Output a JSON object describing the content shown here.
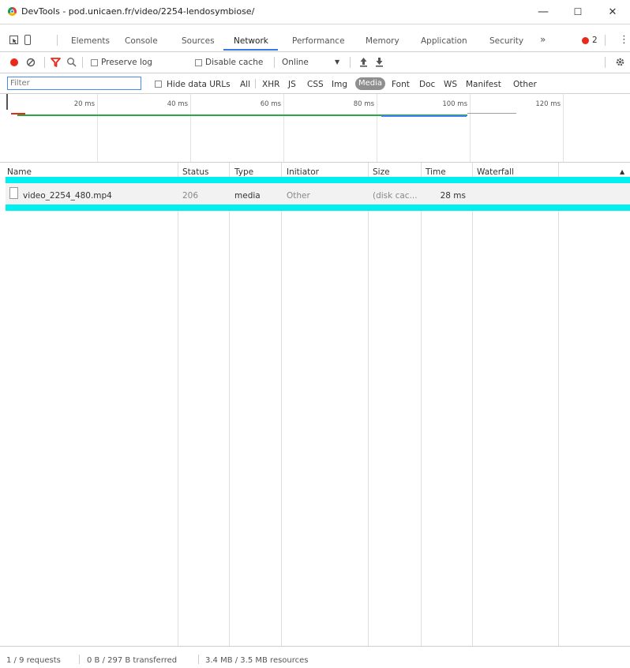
{
  "window": {
    "title": "DevTools - pod.unicaen.fr/video/2254-lendosymbiose/",
    "minimize_glyph": "—",
    "maximize_glyph": "☐",
    "close_glyph": "✕"
  },
  "tabs": {
    "items": [
      "Elements",
      "Console",
      "Sources",
      "Network",
      "Performance",
      "Memory",
      "Application",
      "Security"
    ],
    "active": "Network",
    "overflow_glyph": "»",
    "error_count": "2",
    "more_glyph": "⋮"
  },
  "toolbar": {
    "preserve_log": "Preserve log",
    "disable_cache": "Disable cache",
    "throttle": "Online",
    "throttle_arrow": "▼"
  },
  "filter": {
    "placeholder": "Filter",
    "hide_data_urls": "Hide data URLs",
    "types": [
      "All",
      "XHR",
      "JS",
      "CSS",
      "Img",
      "Media",
      "Font",
      "Doc",
      "WS",
      "Manifest",
      "Other"
    ],
    "active_type": "Media"
  },
  "overview": {
    "ticks": [
      "20 ms",
      "40 ms",
      "60 ms",
      "80 ms",
      "100 ms",
      "120 ms"
    ]
  },
  "table": {
    "columns": [
      "Name",
      "Status",
      "Type",
      "Initiator",
      "Size",
      "Time",
      "Waterfall"
    ],
    "sort_glyph": "▲",
    "rows": [
      {
        "name": "video_2254_480.mp4",
        "status": "206",
        "type": "media",
        "initiator": "Other",
        "size": "(disk cac...",
        "time": "28 ms"
      }
    ]
  },
  "status": {
    "requests": "1 / 9 requests",
    "transferred": "0 B / 297 B transferred",
    "resources": "3.4 MB / 3.5 MB resources"
  },
  "colors": {
    "accent": "#3b78e7",
    "record": "#e8291c",
    "filter_icon": "#e8291c",
    "highlight": "#00f0f0",
    "overview_green": "#27a844",
    "overview_blue": "#4285f4"
  }
}
